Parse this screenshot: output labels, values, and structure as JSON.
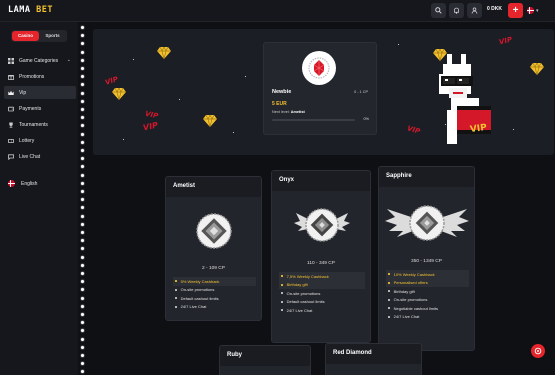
{
  "brand": {
    "logo_pre": "LAMA",
    "logo_post": "BET"
  },
  "header": {
    "balance": "0 DKK",
    "add_label": "+"
  },
  "sidebar": {
    "tabs": [
      {
        "label": "Casino",
        "active": true
      },
      {
        "label": "Sports",
        "active": false
      }
    ],
    "items": [
      {
        "label": "Game Categories",
        "icon": "grid-icon"
      },
      {
        "label": "Promotions",
        "icon": "gift-icon"
      },
      {
        "label": "Vip",
        "icon": "crown-icon",
        "active": true
      },
      {
        "label": "Payments",
        "icon": "wallet-icon"
      },
      {
        "label": "Tournaments",
        "icon": "trophy-icon"
      },
      {
        "label": "Lottery",
        "icon": "ticket-icon"
      },
      {
        "label": "Live Chat",
        "icon": "chat-icon"
      }
    ],
    "language": "English"
  },
  "hero": {
    "vip_word": "VIP",
    "current": {
      "level": "Newbie",
      "cp_range": "0 - 1 CP",
      "reward": "5 EUR",
      "next_label": "Next level:",
      "next_level": "Ametist",
      "progress": 0,
      "progress_label": "0%"
    }
  },
  "tiers": [
    {
      "name": "Ametist",
      "cp": "2 - 109 CP",
      "perks": [
        {
          "text": "5% Weekly Cashback",
          "highlight": true
        },
        {
          "text": "On-site promotions",
          "highlight": false
        },
        {
          "text": "Default cashout limits",
          "highlight": false
        },
        {
          "text": "24/7 Live Chat",
          "highlight": false
        }
      ]
    },
    {
      "name": "Onyx",
      "cp": "110 - 349 CP",
      "perks": [
        {
          "text": "7,5% Weekly Cashback",
          "highlight": true
        },
        {
          "text": "Birthday gift",
          "highlight": true
        },
        {
          "text": "On-site promotions",
          "highlight": false
        },
        {
          "text": "Default cashout limits",
          "highlight": false
        },
        {
          "text": "24/7 Live Chat",
          "highlight": false
        }
      ]
    },
    {
      "name": "Sapphire",
      "cp": "350 - 1349 CP",
      "perks": [
        {
          "text": "10% Weekly Cashback",
          "highlight": true
        },
        {
          "text": "Personalised offers",
          "highlight": true
        },
        {
          "text": "Birthday gift",
          "highlight": false
        },
        {
          "text": "On-site promotions",
          "highlight": false
        },
        {
          "text": "Negotiable cashout limits",
          "highlight": false
        },
        {
          "text": "24/7 Live Chat",
          "highlight": false
        }
      ]
    },
    {
      "name": "Ruby"
    },
    {
      "name": "Red Diamond"
    }
  ],
  "colors": {
    "accent": "#e5242b",
    "gold": "#f2c230",
    "bg": "#0f1014",
    "panel": "#23252c"
  }
}
